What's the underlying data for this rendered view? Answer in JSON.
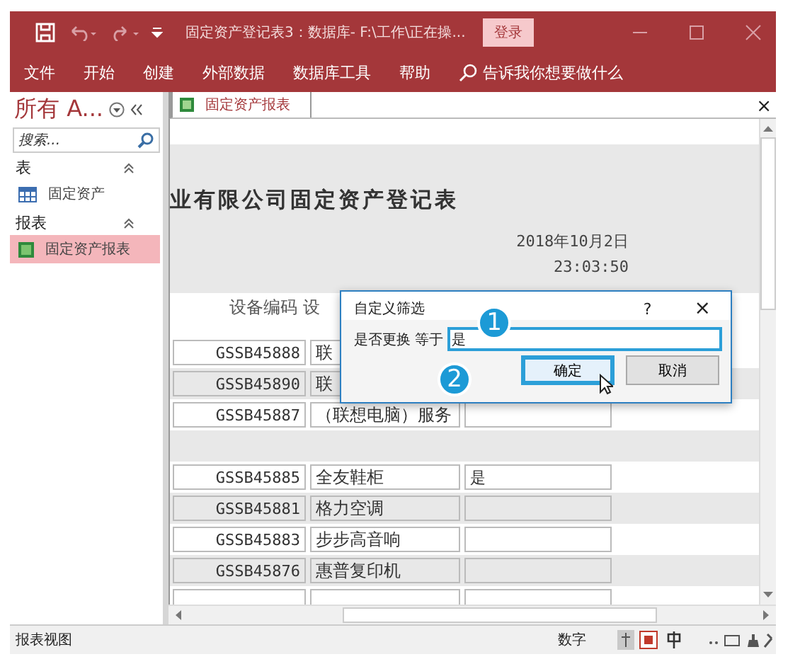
{
  "window": {
    "title": "固定资产登记表3：数据库- F:\\工作\\正在操...",
    "login": "登录"
  },
  "menu": [
    "文件",
    "开始",
    "创建",
    "外部数据",
    "数据库工具",
    "帮助"
  ],
  "tell_me": "告诉我你想要做什么",
  "nav": {
    "title": "所有 A...",
    "search_placeholder": "搜索...",
    "groups": [
      {
        "label": "表",
        "expanded": true,
        "items": [
          {
            "label": "固定资产",
            "kind": "table",
            "selected": false
          }
        ]
      },
      {
        "label": "报表",
        "expanded": true,
        "items": [
          {
            "label": "固定资产报表",
            "kind": "report",
            "selected": true
          }
        ]
      }
    ]
  },
  "doc_tab": {
    "label": "固定资产报表",
    "close": "×"
  },
  "report": {
    "title": "业有限公司固定资产登记表",
    "date": "2018年10月2日",
    "time": "23:03:50",
    "columns": [
      "设备编码",
      "设"
    ],
    "rows": [
      {
        "kind": "covered_record",
        "code": "GSSB45888",
        "name": "联"
      },
      {
        "kind": "covered_record",
        "code": "GSSB45890",
        "name": "联"
      },
      {
        "kind": "record",
        "code": "GSSB45887",
        "name": "（联想电脑）服务"
      },
      {
        "kind": "spacer"
      },
      {
        "kind": "record",
        "code": "GSSB45885",
        "name": "全友鞋柜",
        "replaced": "是"
      },
      {
        "kind": "record",
        "code": "GSSB45881",
        "name": "格力空调"
      },
      {
        "kind": "record",
        "code": "GSSB45883",
        "name": "步步高音响"
      },
      {
        "kind": "record",
        "code": "GSSB45876",
        "name": "惠普复印机"
      }
    ]
  },
  "dialog": {
    "title": "自定义筛选",
    "help": "?",
    "close": "×",
    "label": "是否更换 等于",
    "value": "是",
    "ok": "确定",
    "cancel": "取消",
    "steps": [
      "1",
      "2"
    ]
  },
  "status_bar": {
    "view": "报表视图",
    "mode": "数字"
  }
}
